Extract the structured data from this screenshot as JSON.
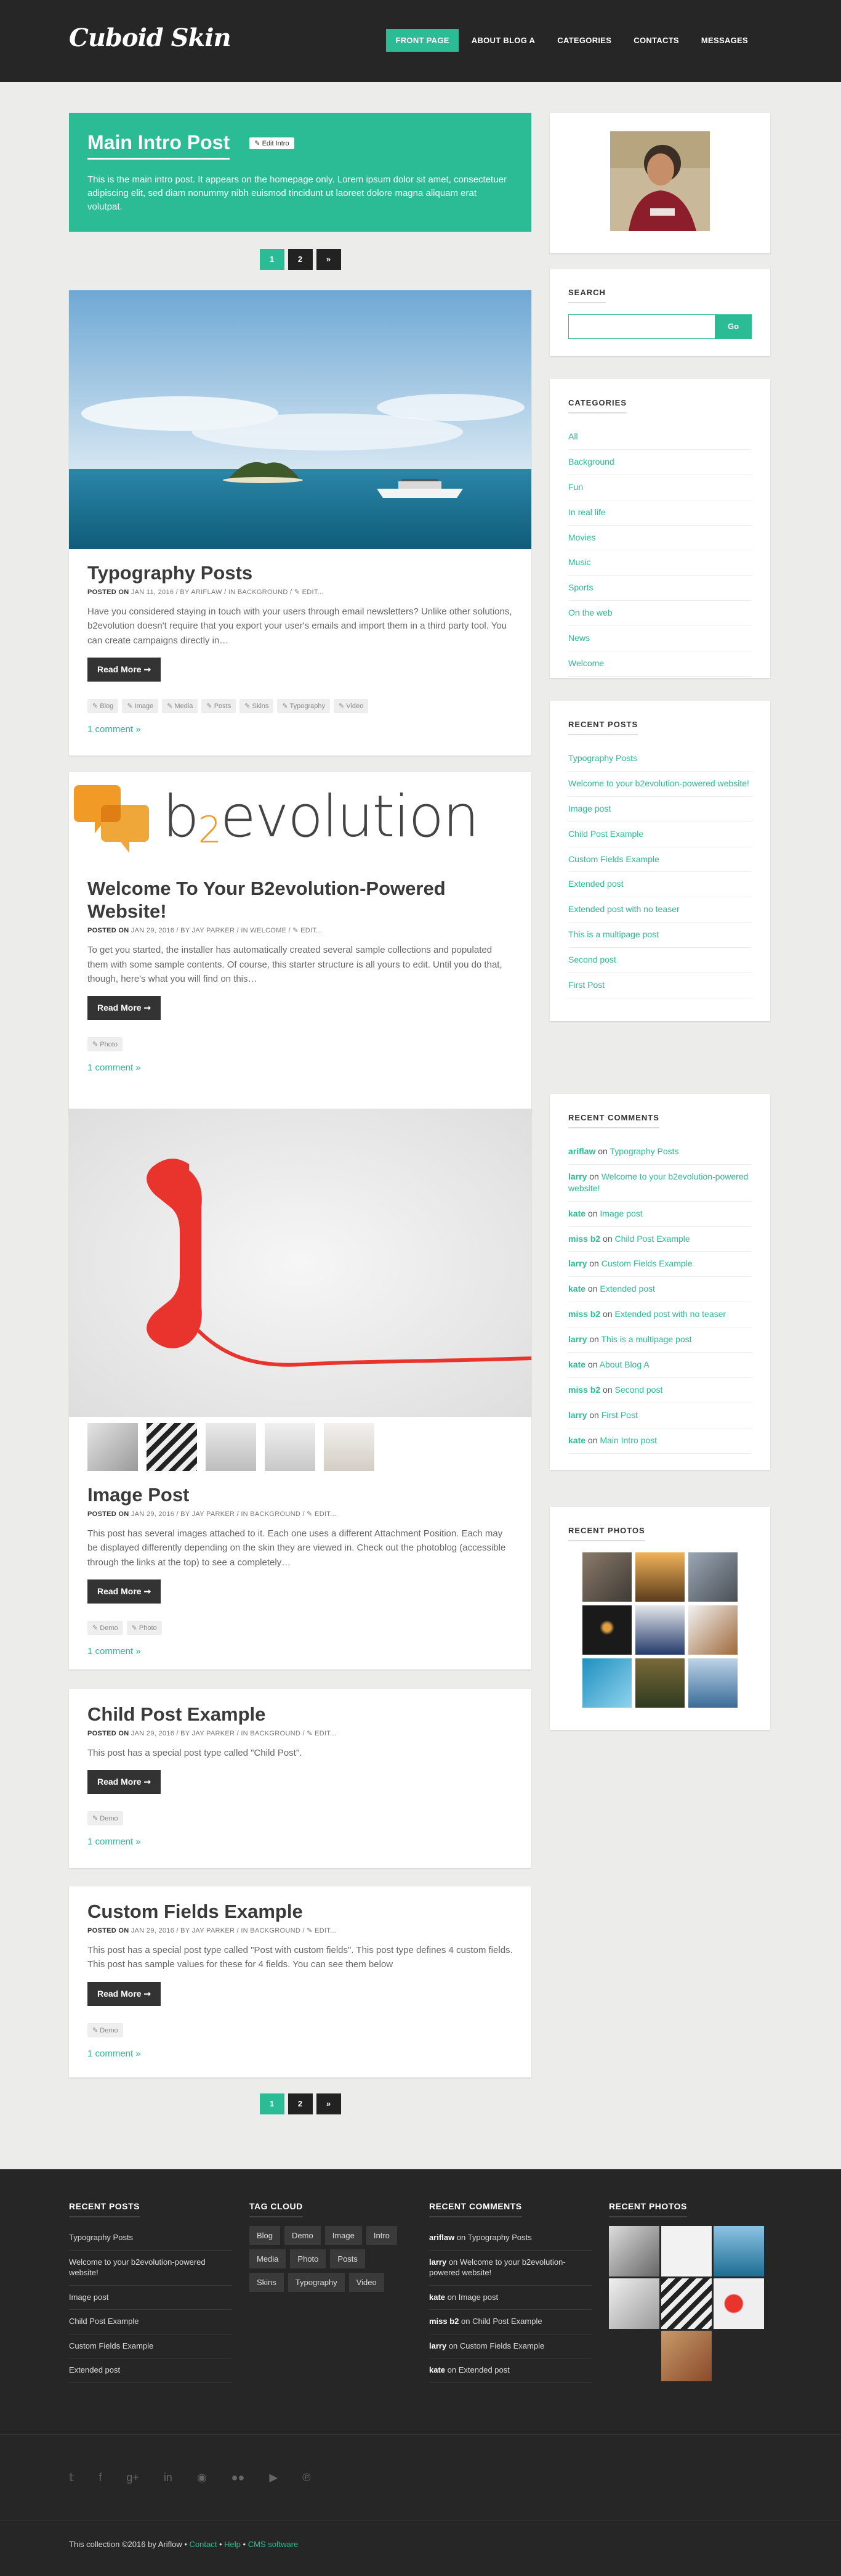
{
  "header": {
    "logo": "Cuboid Skin",
    "nav": [
      "FRONT PAGE",
      "ABOUT BLOG A",
      "CATEGORIES",
      "CONTACTS",
      "MESSAGES"
    ]
  },
  "intro": {
    "title": "Main Intro Post",
    "edit": "Edit Intro",
    "text": "This is the main intro post. It appears on the homepage only. Lorem ipsum dolor sit amet, consectetuer adipiscing elit, sed diam nonummy nibh euismod tincidunt ut laoreet dolore magna aliquam erat volutpat."
  },
  "pager": [
    "1",
    "2",
    "»"
  ],
  "posts": [
    {
      "title": "Typography Posts",
      "meta_prefix": "POSTED ON",
      "meta": "JAN 11, 2016 / BY ARIFLAW / IN BACKGROUND / ✎ EDIT...",
      "excerpt": "Have you considered staying in touch with your users through email newsletters? Unlike other solutions, b2evolution doesn't require that you export your user's emails and import them in a third party tool. You can create campaigns directly in…",
      "readmore": "Read More ➞",
      "tags": [
        "Blog",
        "Image",
        "Media",
        "Posts",
        "Skins",
        "Typography",
        "Video"
      ],
      "comments": "1 comment »"
    },
    {
      "title": "Welcome To Your B2evolution-Powered Website!",
      "meta_prefix": "POSTED ON",
      "meta": "JAN 29, 2016 / BY JAY PARKER / IN WELCOME / ✎ EDIT...",
      "excerpt": "To get you started, the installer has automatically created several sample collections and populated them with some sample contents. Of course, this starter structure is all yours to edit. Until you do that, though, here's what you will find on this…",
      "readmore": "Read More ➞",
      "tags": [
        "Photo"
      ],
      "comments": "1 comment »",
      "logo_b": "b",
      "logo_2": "2",
      "logo_rest": "evolution"
    },
    {
      "title": "Image Post",
      "meta_prefix": "POSTED ON",
      "meta": "JAN 29, 2016 / BY JAY PARKER / IN BACKGROUND / ✎ EDIT...",
      "excerpt": "This post has several images attached to it. Each one uses a different Attachment Position. Each may be displayed differently depending on the skin they are viewed in. Check out the photoblog (accessible through the links at the top) to see a completely…",
      "readmore": "Read More ➞",
      "tags": [
        "Demo",
        "Photo"
      ],
      "comments": "1 comment »"
    },
    {
      "title": "Child Post Example",
      "meta_prefix": "POSTED ON",
      "meta": "JAN 29, 2016 / BY JAY PARKER / IN BACKGROUND / ✎ EDIT...",
      "excerpt": "This post has a special post type called \"Child Post\".",
      "readmore": "Read More ➞",
      "tags": [
        "Demo"
      ],
      "comments": "1 comment »"
    },
    {
      "title": "Custom Fields Example",
      "meta_prefix": "POSTED ON",
      "meta": "JAN 29, 2016 / BY JAY PARKER / IN BACKGROUND / ✎ EDIT...",
      "excerpt": "This post has a special post type called \"Post with custom fields\". This post type defines 4 custom fields. This post has sample values for these for 4 fields. You can see them below",
      "readmore": "Read More ➞",
      "tags": [
        "Demo"
      ],
      "comments": "1 comment »"
    }
  ],
  "sidebar": {
    "search_title": "SEARCH",
    "search_button": "Go",
    "search_value": "",
    "categories_title": "CATEGORIES",
    "categories": [
      "All",
      "Background",
      "Fun",
      "In real life",
      "Movies",
      "Music",
      "Sports",
      "On the web",
      "News",
      "Welcome"
    ],
    "recent_posts_title": "RECENT POSTS",
    "recent_posts": [
      "Typography Posts",
      "Welcome to your b2evolution-powered website!",
      "Image post",
      "Child Post Example",
      "Custom Fields Example",
      "Extended post",
      "Extended post with no teaser",
      "This is a multipage post",
      "Second post",
      "First Post"
    ],
    "recent_comments_title": "RECENT COMMENTS",
    "on": "on",
    "recent_comments": [
      {
        "user": "ariflaw",
        "post": "Typography Posts"
      },
      {
        "user": "larry",
        "post": "Welcome to your b2evolution-powered website!"
      },
      {
        "user": "kate",
        "post": "Image post"
      },
      {
        "user": "miss b2",
        "post": "Child Post Example"
      },
      {
        "user": "larry",
        "post": "Custom Fields Example"
      },
      {
        "user": "kate",
        "post": "Extended post"
      },
      {
        "user": "miss b2",
        "post": "Extended post with no teaser"
      },
      {
        "user": "larry",
        "post": "This is a multipage post"
      },
      {
        "user": "kate",
        "post": "About Blog A"
      },
      {
        "user": "miss b2",
        "post": "Second post"
      },
      {
        "user": "larry",
        "post": "First Post"
      },
      {
        "user": "kate",
        "post": "Main Intro post"
      }
    ],
    "recent_photos_title": "RECENT PHOTOS"
  },
  "footer": {
    "recent_posts_title": "RECENT POSTS",
    "recent_posts": [
      "Typography Posts",
      "Welcome to your b2evolution-powered website!",
      "Image post",
      "Child Post Example",
      "Custom Fields Example",
      "Extended post"
    ],
    "tag_cloud_title": "TAG CLOUD",
    "tags": [
      "Blog",
      "Demo",
      "Image",
      "Intro",
      "Media",
      "Photo",
      "Posts",
      "Skins",
      "Typography",
      "Video"
    ],
    "recent_comments_title": "RECENT COMMENTS",
    "on": "on",
    "recent_comments": [
      {
        "user": "ariflaw",
        "post": "Typography Posts"
      },
      {
        "user": "larry",
        "post": "Welcome to your b2evolution-powered website!"
      },
      {
        "user": "kate",
        "post": "Image post"
      },
      {
        "user": "miss b2",
        "post": "Child Post Example"
      },
      {
        "user": "larry",
        "post": "Custom Fields Example"
      },
      {
        "user": "kate",
        "post": "Extended post"
      }
    ],
    "recent_photos_title": "RECENT PHOTOS",
    "copyright_prefix": "This collection ©2016 by Ariflow •",
    "contact": "Contact",
    "help": "Help",
    "cms": "CMS software",
    "sep": "•"
  },
  "colors": {
    "accent": "#2bbb95",
    "dark": "#262626"
  },
  "icons": [
    "twitter-icon",
    "facebook-icon",
    "googleplus-icon",
    "linkedin-icon",
    "github-icon",
    "flickr-icon",
    "youtube-icon",
    "pinterest-icon"
  ]
}
